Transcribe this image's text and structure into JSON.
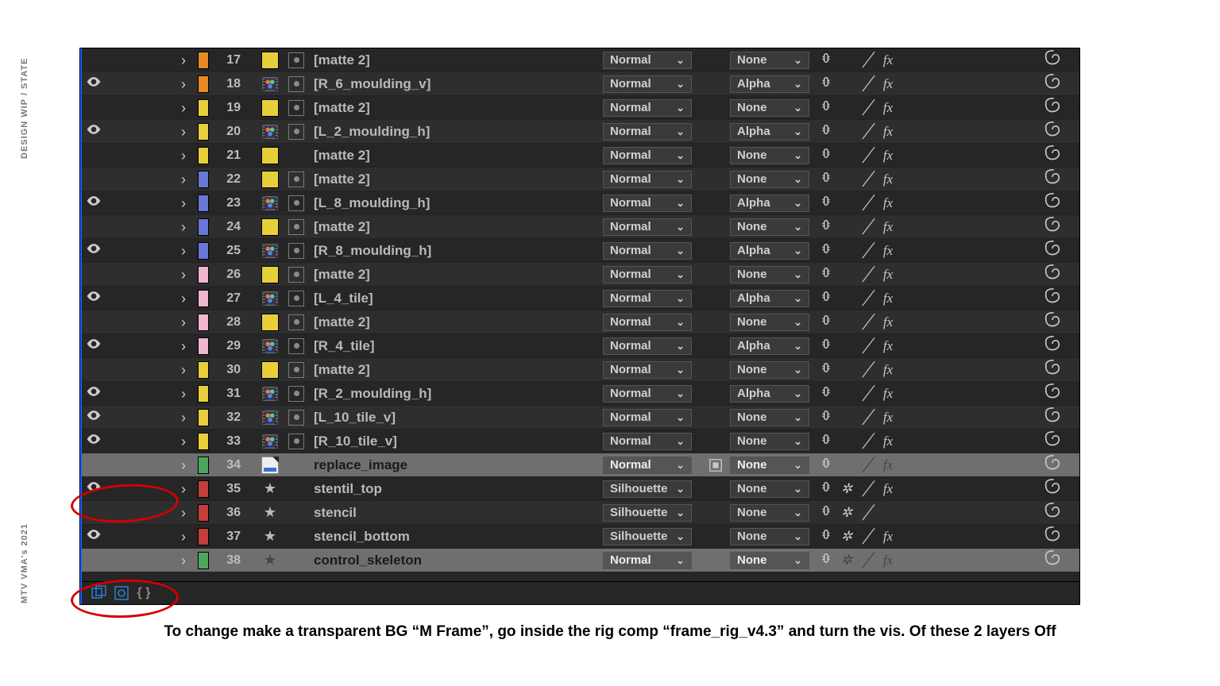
{
  "sidebar_text": {
    "top": "DESIGN WIP / STATE",
    "bottom": "MTV VMA's 2021"
  },
  "caption": "To change make a transparent BG “M Frame”, go inside the rig comp “frame_rig_v4.3” and turn the vis. Of  these 2 layers Off",
  "colors": {
    "orange": "#e58a26",
    "yellow": "#e7cf3b",
    "blue": "#6a77d6",
    "pink": "#f0b6cf",
    "green": "#4fa65b",
    "red": "#c23f3a"
  },
  "layers": [
    {
      "n": 17,
      "label": "orange",
      "eye": false,
      "film": false,
      "swatch": "yellow",
      "adj": true,
      "name": "[matte 2]",
      "mode": "Normal",
      "trk": false,
      "track": "None",
      "sun": false,
      "fx": true,
      "mb": true,
      "sel": false
    },
    {
      "n": 18,
      "label": "orange",
      "eye": true,
      "film": true,
      "swatch": null,
      "adj": true,
      "name": "[R_6_moulding_v]",
      "mode": "Normal",
      "trk": false,
      "track": "Alpha",
      "sun": false,
      "fx": true,
      "mb": true,
      "sel": false
    },
    {
      "n": 19,
      "label": "yellow",
      "eye": false,
      "film": false,
      "swatch": "yellow",
      "adj": true,
      "name": "[matte 2]",
      "mode": "Normal",
      "trk": false,
      "track": "None",
      "sun": false,
      "fx": true,
      "mb": true,
      "sel": false
    },
    {
      "n": 20,
      "label": "yellow",
      "eye": true,
      "film": true,
      "swatch": null,
      "adj": true,
      "name": "[L_2_moulding_h]",
      "mode": "Normal",
      "trk": false,
      "track": "Alpha",
      "sun": false,
      "fx": true,
      "mb": true,
      "sel": false
    },
    {
      "n": 21,
      "label": "yellow",
      "eye": false,
      "film": false,
      "swatch": "yellow",
      "adj": false,
      "name": "[matte 2]",
      "mode": "Normal",
      "trk": false,
      "track": "None",
      "sun": false,
      "fx": true,
      "mb": true,
      "sel": false
    },
    {
      "n": 22,
      "label": "blue",
      "eye": false,
      "film": false,
      "swatch": "yellow",
      "adj": true,
      "name": "[matte 2]",
      "mode": "Normal",
      "trk": false,
      "track": "None",
      "sun": false,
      "fx": true,
      "mb": true,
      "sel": false
    },
    {
      "n": 23,
      "label": "blue",
      "eye": true,
      "film": true,
      "swatch": null,
      "adj": true,
      "name": "[L_8_moulding_h]",
      "mode": "Normal",
      "trk": false,
      "track": "Alpha",
      "sun": false,
      "fx": true,
      "mb": true,
      "sel": false
    },
    {
      "n": 24,
      "label": "blue",
      "eye": false,
      "film": false,
      "swatch": "yellow",
      "adj": true,
      "name": "[matte 2]",
      "mode": "Normal",
      "trk": false,
      "track": "None",
      "sun": false,
      "fx": true,
      "mb": true,
      "sel": false
    },
    {
      "n": 25,
      "label": "blue",
      "eye": true,
      "film": true,
      "swatch": null,
      "adj": true,
      "name": "[R_8_moulding_h]",
      "mode": "Normal",
      "trk": false,
      "track": "Alpha",
      "sun": false,
      "fx": true,
      "mb": true,
      "sel": false
    },
    {
      "n": 26,
      "label": "pink",
      "eye": false,
      "film": false,
      "swatch": "yellow",
      "adj": true,
      "name": "[matte 2]",
      "mode": "Normal",
      "trk": false,
      "track": "None",
      "sun": false,
      "fx": true,
      "mb": true,
      "sel": false
    },
    {
      "n": 27,
      "label": "pink",
      "eye": true,
      "film": true,
      "swatch": null,
      "adj": true,
      "name": "[L_4_tile]",
      "mode": "Normal",
      "trk": false,
      "track": "Alpha",
      "sun": false,
      "fx": true,
      "mb": true,
      "sel": false
    },
    {
      "n": 28,
      "label": "pink",
      "eye": false,
      "film": false,
      "swatch": "yellow",
      "adj": true,
      "name": "[matte 2]",
      "mode": "Normal",
      "trk": false,
      "track": "None",
      "sun": false,
      "fx": true,
      "mb": true,
      "sel": false
    },
    {
      "n": 29,
      "label": "pink",
      "eye": true,
      "film": true,
      "swatch": null,
      "adj": true,
      "name": "[R_4_tile]",
      "mode": "Normal",
      "trk": false,
      "track": "Alpha",
      "sun": false,
      "fx": true,
      "mb": true,
      "sel": false
    },
    {
      "n": 30,
      "label": "yellow",
      "eye": false,
      "film": false,
      "swatch": "yellow",
      "adj": true,
      "name": "[matte 2]",
      "mode": "Normal",
      "trk": false,
      "track": "None",
      "sun": false,
      "fx": true,
      "mb": true,
      "sel": false
    },
    {
      "n": 31,
      "label": "yellow",
      "eye": true,
      "film": true,
      "swatch": null,
      "adj": true,
      "name": "[R_2_moulding_h]",
      "mode": "Normal",
      "trk": false,
      "track": "Alpha",
      "sun": false,
      "fx": true,
      "mb": true,
      "sel": false
    },
    {
      "n": 32,
      "label": "yellow",
      "eye": true,
      "film": true,
      "swatch": null,
      "adj": false,
      "name": "[L_10_tile_v]",
      "mode": "Normal",
      "trk": false,
      "track": "None",
      "sun": false,
      "fx": true,
      "mb": true,
      "sel": false
    },
    {
      "n": 33,
      "label": "yellow",
      "eye": true,
      "film": true,
      "swatch": null,
      "adj": false,
      "name": "[R_10_tile_v]",
      "mode": "Normal",
      "trk": false,
      "track": "None",
      "sun": false,
      "fx": true,
      "mb": true,
      "sel": false
    },
    {
      "n": 34,
      "label": "green",
      "eye": false,
      "film": false,
      "swatch": null,
      "adj": false,
      "name": "replace_image",
      "mode": "Normal",
      "trk": true,
      "track": "None",
      "sun": false,
      "fx": true,
      "mb": true,
      "sel": true,
      "icon": "jpeg"
    },
    {
      "n": 35,
      "label": "red",
      "eye": true,
      "film": false,
      "swatch": null,
      "adj": false,
      "name": "stentil_top",
      "mode": "Silhouette",
      "trk": false,
      "track": "None",
      "sun": true,
      "fx": true,
      "mb": true,
      "sel": false,
      "icon": "star"
    },
    {
      "n": 36,
      "label": "red",
      "eye": false,
      "film": false,
      "swatch": null,
      "adj": false,
      "name": "stencil",
      "mode": "Silhouette",
      "trk": false,
      "track": "None",
      "sun": true,
      "fx": false,
      "mb": true,
      "sel": false,
      "icon": "star"
    },
    {
      "n": 37,
      "label": "red",
      "eye": true,
      "film": false,
      "swatch": null,
      "adj": false,
      "name": "stencil_bottom",
      "mode": "Silhouette",
      "trk": false,
      "track": "None",
      "sun": true,
      "fx": true,
      "mb": true,
      "sel": false,
      "icon": "star"
    },
    {
      "n": 38,
      "label": "green",
      "eye": false,
      "film": false,
      "swatch": null,
      "adj": false,
      "name": "control_skeleton",
      "mode": "Normal",
      "trk": false,
      "track": "None",
      "sun": true,
      "fx": true,
      "mb": true,
      "sel": true,
      "icon": "star"
    }
  ]
}
